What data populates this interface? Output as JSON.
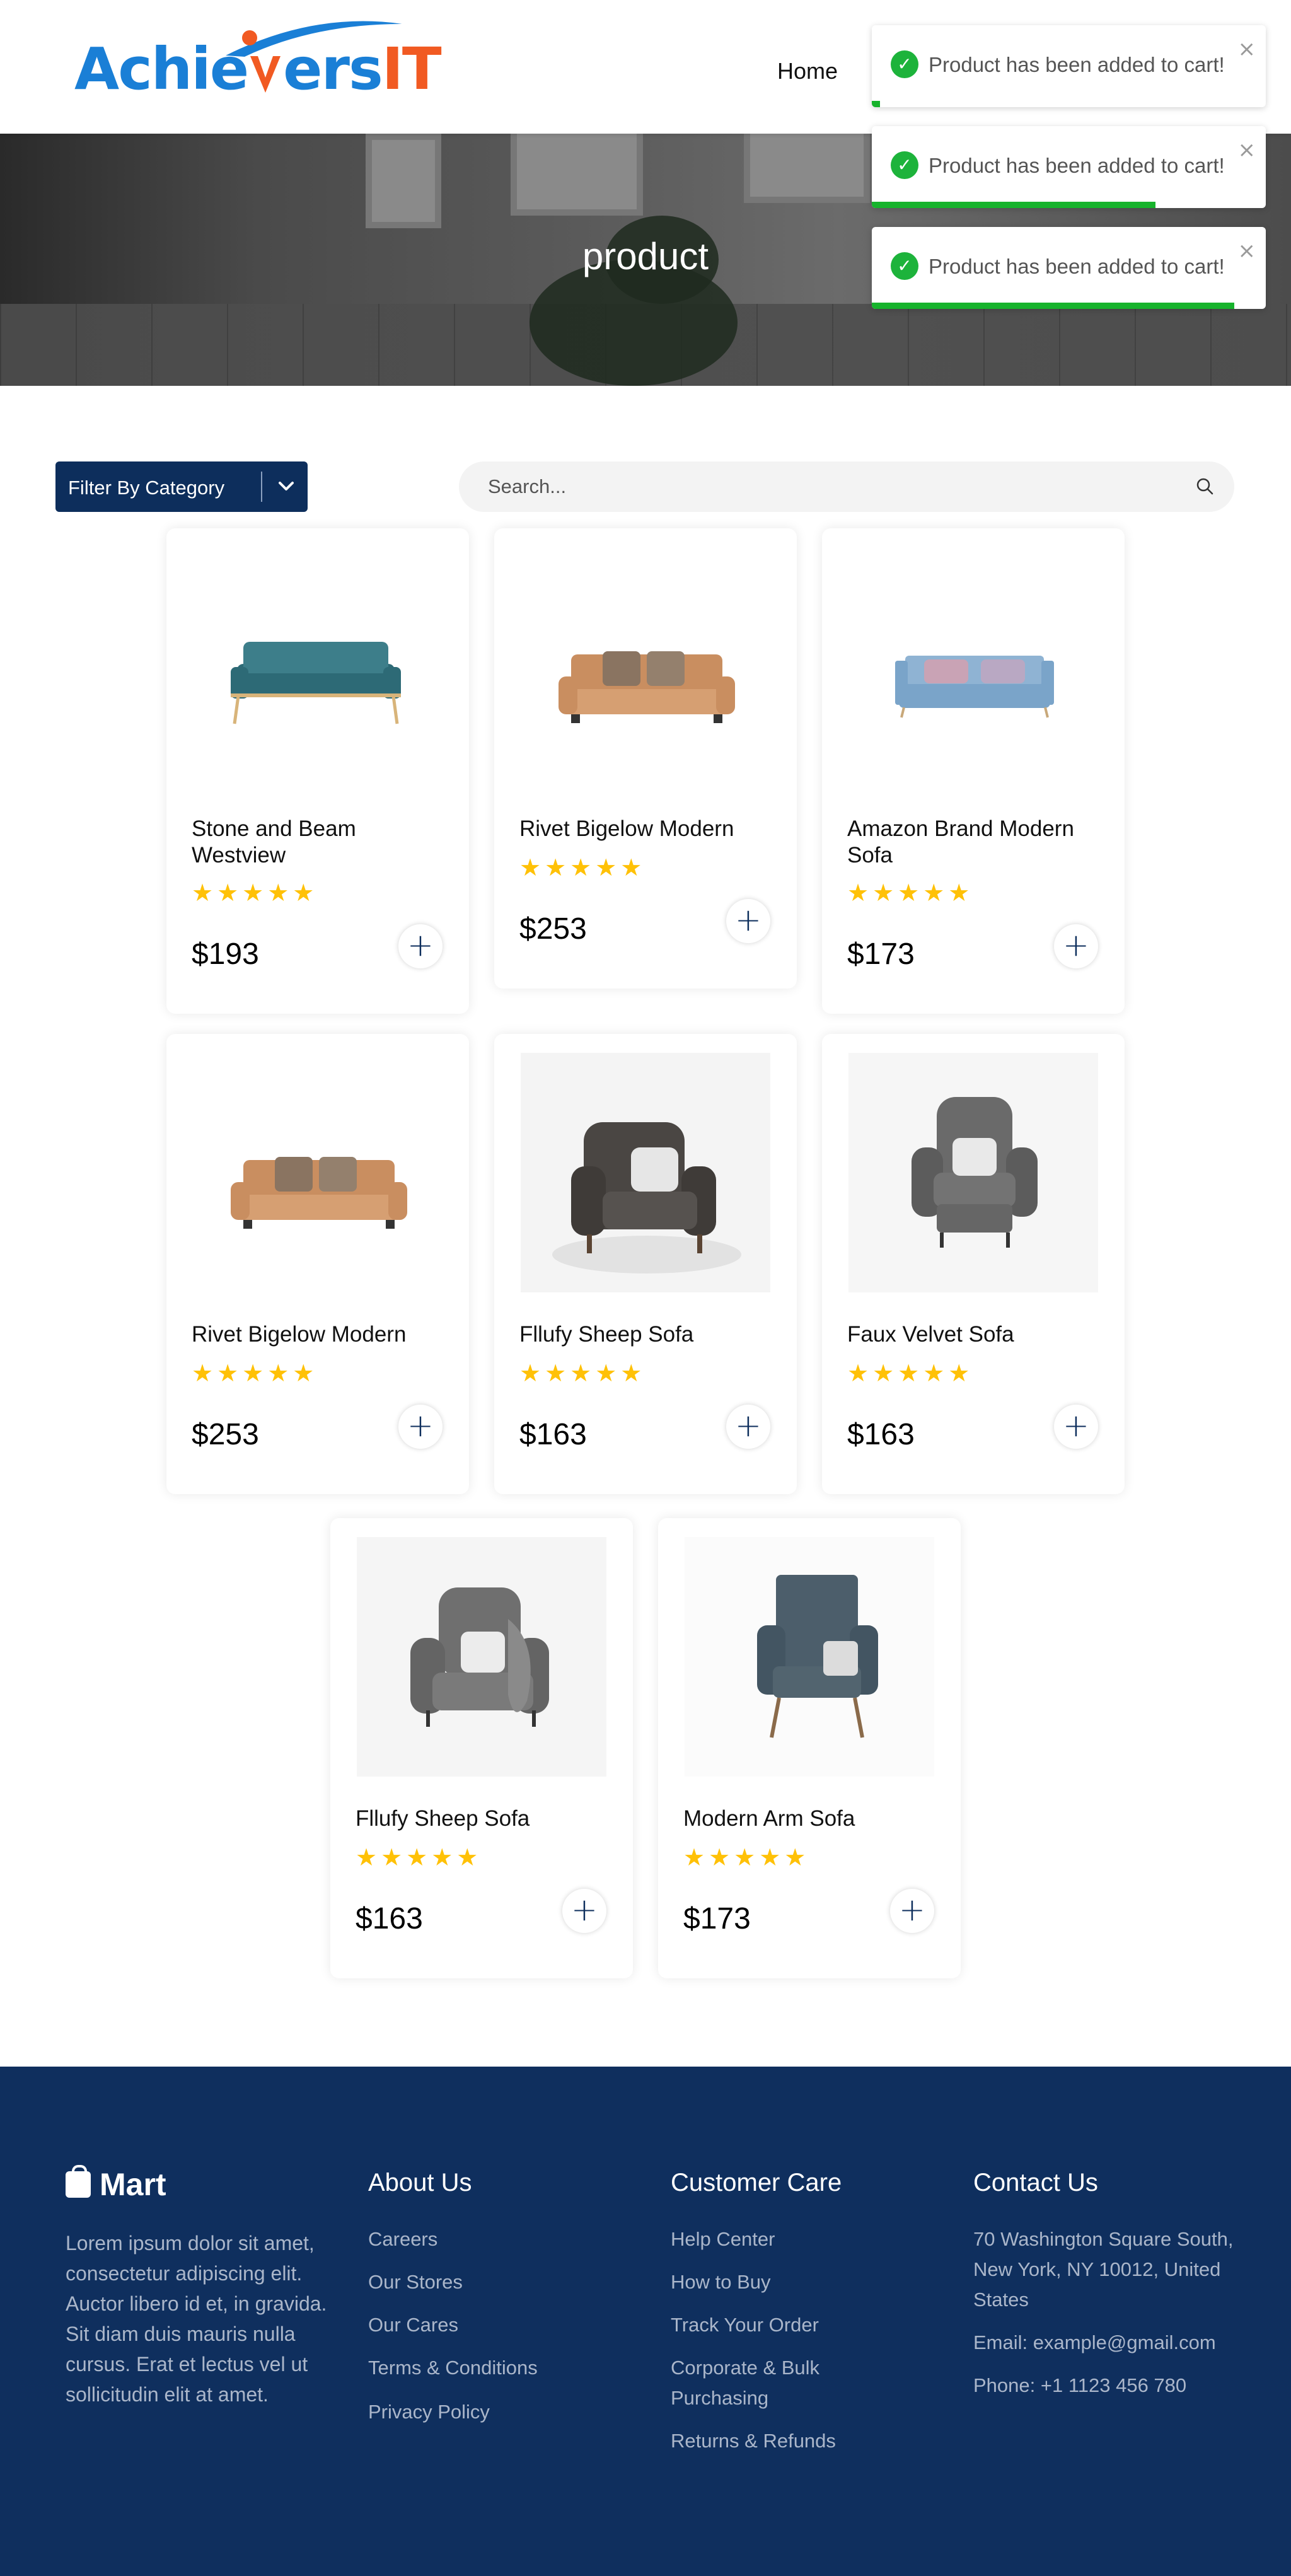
{
  "header": {
    "logo_text_a": "Achie",
    "logo_text_b": "ers",
    "logo_text_c": "IT",
    "nav": {
      "home": "Home"
    }
  },
  "hero": {
    "title": "product"
  },
  "toasts": [
    {
      "message": "Product has been added to cart!",
      "progress": 0.02
    },
    {
      "message": "Product has been added to cart!",
      "progress": 0.72
    },
    {
      "message": "Product has been added to cart!",
      "progress": 0.92
    }
  ],
  "filter": {
    "label": "Filter By Category"
  },
  "search": {
    "placeholder": "Search..."
  },
  "products": [
    {
      "name": "Stone and Beam Westview",
      "price": "$193",
      "rating": 5,
      "image": "sofa-teal"
    },
    {
      "name": "Rivet Bigelow Modern",
      "price": "$253",
      "rating": 5,
      "image": "sofa-tan"
    },
    {
      "name": "Amazon Brand Modern Sofa",
      "price": "$173",
      "rating": 5,
      "image": "sofa-lightblue"
    },
    {
      "name": "Rivet Bigelow Modern",
      "price": "$253",
      "rating": 5,
      "image": "sofa-tan"
    },
    {
      "name": "Fllufy Sheep Sofa",
      "price": "$163",
      "rating": 5,
      "image": "armchair-dark"
    },
    {
      "name": "Faux Velvet Sofa",
      "price": "$163",
      "rating": 5,
      "image": "wingchair-gray"
    },
    {
      "name": "Fllufy Sheep Sofa",
      "price": "$163",
      "rating": 5,
      "image": "wingchair-fur"
    },
    {
      "name": "Modern Arm Sofa",
      "price": "$173",
      "rating": 5,
      "image": "armchair-modern"
    }
  ],
  "stars_text": "★★★★★",
  "colors": {
    "primary": "#0d2e5c",
    "star": "#ffc107",
    "toast_success": "#17b32c",
    "footer_bg": "#0f2f5e"
  },
  "footer": {
    "brand": "Mart",
    "description": "Lorem ipsum dolor sit amet, consectetur adipiscing elit. Auctor libero id et, in gravida. Sit diam duis mauris nulla cursus. Erat et lectus vel ut sollicitudin elit at amet.",
    "about": {
      "title": "About Us",
      "links": [
        "Careers",
        "Our Stores",
        "Our Cares",
        "Terms & Conditions",
        "Privacy Policy"
      ]
    },
    "care": {
      "title": "Customer Care",
      "links": [
        "Help Center",
        "How to Buy",
        "Track Your Order",
        "Corporate & Bulk Purchasing",
        "Returns & Refunds"
      ]
    },
    "contact": {
      "title": "Contact Us",
      "address": "70 Washington Square South, New York, NY 10012, United States",
      "email": "Email: example@gmail.com",
      "phone": "Phone: +1 1123 456 780"
    }
  }
}
